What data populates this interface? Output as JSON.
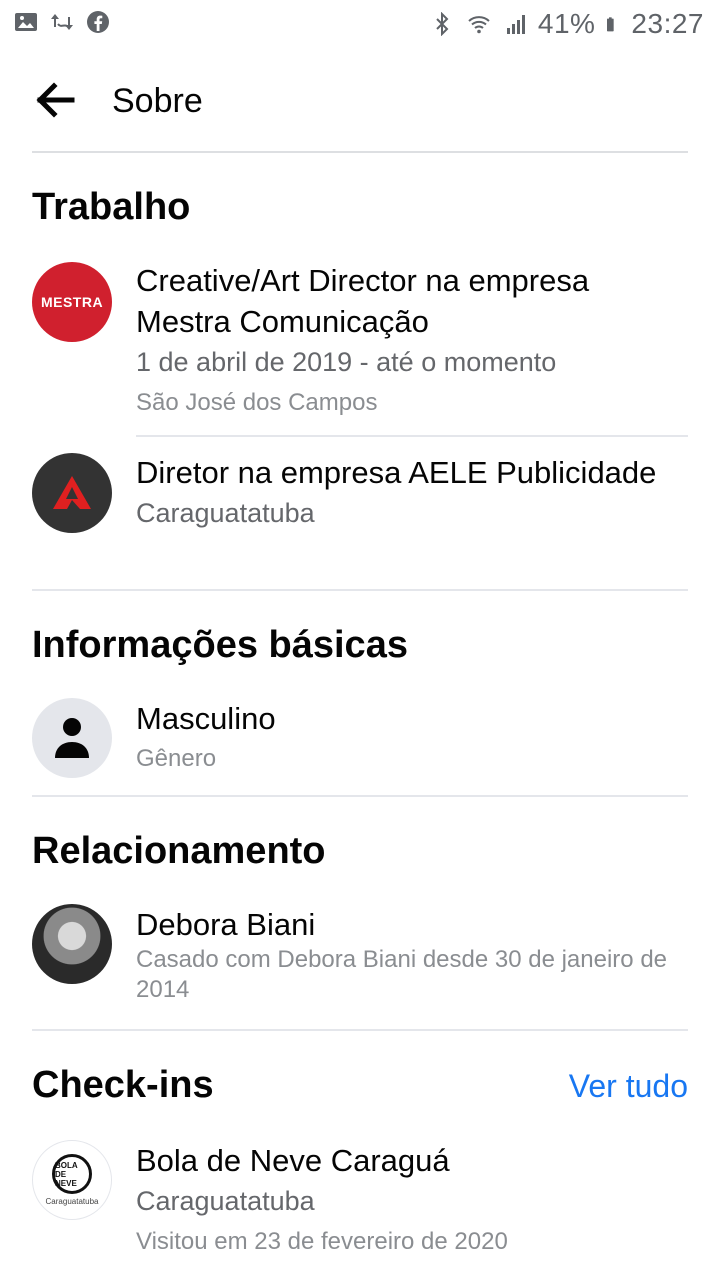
{
  "status_bar": {
    "battery": "41%",
    "time": "23:27"
  },
  "header": {
    "title": "Sobre"
  },
  "work": {
    "title": "Trabalho",
    "items": [
      {
        "logo_text": "MESTRA",
        "primary": "Creative/Art Director na empresa Mestra Comunicação",
        "secondary": "1 de abril de 2019 - até o momento",
        "tertiary": "São José dos Campos"
      },
      {
        "primary": "Diretor na empresa AELE Publicidade",
        "secondary": "Caraguatatuba"
      }
    ]
  },
  "basic": {
    "title": "Informações básicas",
    "items": [
      {
        "primary": "Masculino",
        "secondary": "Gênero"
      }
    ]
  },
  "relationship": {
    "title": "Relacionamento",
    "items": [
      {
        "primary": "Debora Biani",
        "secondary": "Casado com Debora Biani desde 30 de janeiro de 2014"
      }
    ]
  },
  "checkins": {
    "title": "Check-ins",
    "see_all": "Ver tudo",
    "items": [
      {
        "logo_text": "BOLA DE NEVE",
        "logo_sub": "Caraguatatuba",
        "primary": "Bola de Neve Caraguá",
        "secondary": "Caraguatatuba",
        "tertiary": "Visitou em 23 de fevereiro de 2020"
      }
    ]
  },
  "colors": {
    "accent": "#1877f2",
    "mestra": "#d0202e",
    "aele": "#333333"
  }
}
